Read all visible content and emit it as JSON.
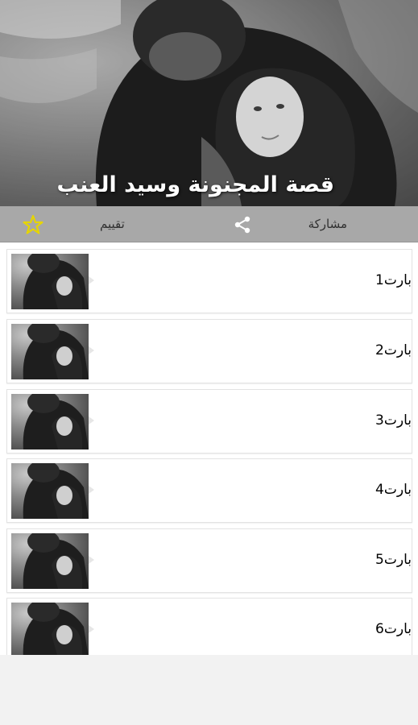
{
  "header": {
    "title": "قصة المجنونة وسيد العنب",
    "image": "couple-photo"
  },
  "actions": {
    "share_label": "مشاركة",
    "share_icon": "share-icon",
    "rate_label": "تقييم",
    "rate_icon": "star-icon",
    "star_color": "#e6d500"
  },
  "list": {
    "items": [
      {
        "label": "بارت1"
      },
      {
        "label": "بارت2"
      },
      {
        "label": "بارت3"
      },
      {
        "label": "بارت4"
      },
      {
        "label": "بارت5"
      },
      {
        "label": "بارت6"
      }
    ]
  }
}
